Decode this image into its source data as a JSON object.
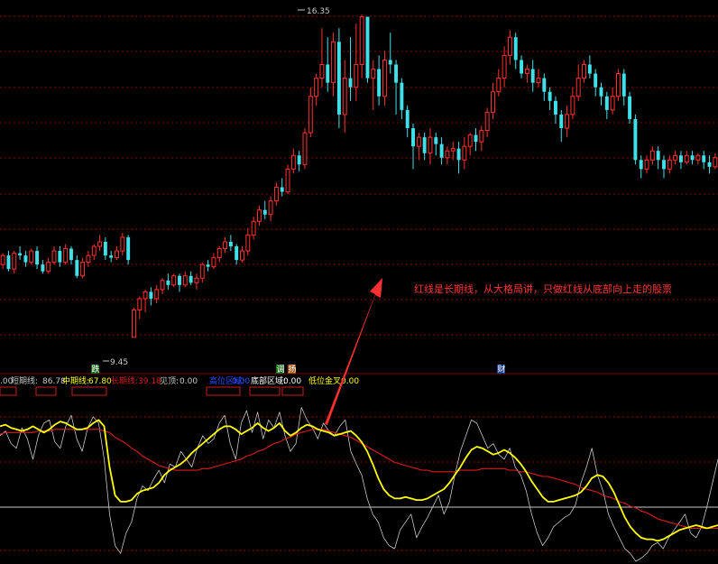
{
  "chart_data": [
    {
      "type": "candlestick",
      "price_high_label": "16.35",
      "price_low_label": "9.45",
      "ylim": [
        8.7,
        16.6
      ],
      "colors": {
        "up": "#ff3030",
        "down": "#40e0e8"
      },
      "candles": [
        [
          10.9,
          11.1,
          11.15,
          10.8
        ],
        [
          11.1,
          10.8,
          11.2,
          10.75
        ],
        [
          10.8,
          11.15,
          11.2,
          10.7
        ],
        [
          11.15,
          11.1,
          11.3,
          11.0
        ],
        [
          11.1,
          10.95,
          11.2,
          10.85
        ],
        [
          10.95,
          11.2,
          11.25,
          10.9
        ],
        [
          11.2,
          10.9,
          11.3,
          10.8
        ],
        [
          10.9,
          10.75,
          11.0,
          10.7
        ],
        [
          10.75,
          10.95,
          11.05,
          10.7
        ],
        [
          10.95,
          11.2,
          11.3,
          10.9
        ],
        [
          11.2,
          10.95,
          11.3,
          10.85
        ],
        [
          10.95,
          11.25,
          11.35,
          10.9
        ],
        [
          11.25,
          11.0,
          11.3,
          10.9
        ],
        [
          11.0,
          10.65,
          11.1,
          10.6
        ],
        [
          10.65,
          10.95,
          11.05,
          10.6
        ],
        [
          10.95,
          11.1,
          11.2,
          10.85
        ],
        [
          11.1,
          11.3,
          11.35,
          11.0
        ],
        [
          11.3,
          11.4,
          11.55,
          11.2
        ],
        [
          11.4,
          11.1,
          11.5,
          11.0
        ],
        [
          11.1,
          11.05,
          11.2,
          10.95
        ],
        [
          11.05,
          11.2,
          11.3,
          11.0
        ],
        [
          11.2,
          11.5,
          11.6,
          11.1
        ],
        [
          11.5,
          11.0,
          11.55,
          10.9
        ],
        [
          9.3,
          9.9,
          9.95,
          9.45
        ],
        [
          9.9,
          10.15,
          10.2,
          9.7
        ],
        [
          10.15,
          10.3,
          10.35,
          9.85
        ],
        [
          10.3,
          10.15,
          10.4,
          10.0
        ],
        [
          10.15,
          10.35,
          10.45,
          10.05
        ],
        [
          10.35,
          10.55,
          10.6,
          10.25
        ],
        [
          10.55,
          10.45,
          10.7,
          10.35
        ],
        [
          10.45,
          10.65,
          10.7,
          10.4
        ],
        [
          10.65,
          10.45,
          10.7,
          10.3
        ],
        [
          10.45,
          10.65,
          10.75,
          10.4
        ],
        [
          10.65,
          10.5,
          10.75,
          10.45
        ],
        [
          10.5,
          10.6,
          10.7,
          10.35
        ],
        [
          10.6,
          10.9,
          10.95,
          10.5
        ],
        [
          10.9,
          10.85,
          11.0,
          10.75
        ],
        [
          10.85,
          11.05,
          11.15,
          10.8
        ],
        [
          11.05,
          11.25,
          11.3,
          10.95
        ],
        [
          11.25,
          11.4,
          11.5,
          11.15
        ],
        [
          11.4,
          11.3,
          11.55,
          11.2
        ],
        [
          11.3,
          11.0,
          11.35,
          10.9
        ],
        [
          11.0,
          11.2,
          11.3,
          10.95
        ],
        [
          11.2,
          11.55,
          11.7,
          11.1
        ],
        [
          11.55,
          11.85,
          11.95,
          11.45
        ],
        [
          11.85,
          12.1,
          12.2,
          11.75
        ],
        [
          12.1,
          12.0,
          12.3,
          11.9
        ],
        [
          12.0,
          12.3,
          12.4,
          11.85
        ],
        [
          12.3,
          12.6,
          12.7,
          12.2
        ],
        [
          12.6,
          12.5,
          12.8,
          12.4
        ],
        [
          12.5,
          13.0,
          13.1,
          12.45
        ],
        [
          13.0,
          13.3,
          13.45,
          12.9
        ],
        [
          13.3,
          13.1,
          13.4,
          12.95
        ],
        [
          13.1,
          13.8,
          13.9,
          13.0
        ],
        [
          13.8,
          14.6,
          14.8,
          13.7
        ],
        [
          14.6,
          15.0,
          15.1,
          14.4
        ],
        [
          15.0,
          15.3,
          16.1,
          14.8
        ],
        [
          15.3,
          14.9,
          15.9,
          14.7
        ],
        [
          14.9,
          15.8,
          16.0,
          14.6
        ],
        [
          15.8,
          14.2,
          16.1,
          13.9
        ],
        [
          14.2,
          15.0,
          15.4,
          13.8
        ],
        [
          15.0,
          14.8,
          15.9,
          14.5
        ],
        [
          14.8,
          15.3,
          16.2,
          14.5
        ],
        [
          15.3,
          16.35,
          16.4,
          15.0
        ],
        [
          16.35,
          15.0,
          16.35,
          14.9
        ],
        [
          15.0,
          15.2,
          15.4,
          14.3
        ],
        [
          15.2,
          14.6,
          15.5,
          14.4
        ],
        [
          14.6,
          15.4,
          15.6,
          14.4
        ],
        [
          15.4,
          15.3,
          16.0,
          15.1
        ],
        [
          15.3,
          14.9,
          15.4,
          14.2
        ],
        [
          14.9,
          14.3,
          15.0,
          14.1
        ],
        [
          14.3,
          13.9,
          14.4,
          13.7
        ],
        [
          13.9,
          13.5,
          14.0,
          13.0
        ],
        [
          13.5,
          13.7,
          13.8,
          13.2
        ],
        [
          13.7,
          13.35,
          13.8,
          13.2
        ],
        [
          13.35,
          13.7,
          13.9,
          13.1
        ],
        [
          13.7,
          13.55,
          13.8,
          13.3
        ],
        [
          13.55,
          13.25,
          13.7,
          13.1
        ],
        [
          13.25,
          13.4,
          13.5,
          13.1
        ],
        [
          13.4,
          13.45,
          13.6,
          13.2
        ],
        [
          13.45,
          13.2,
          13.6,
          12.9
        ],
        [
          13.2,
          13.5,
          13.7,
          13.0
        ],
        [
          13.5,
          13.75,
          13.8,
          13.3
        ],
        [
          13.75,
          13.6,
          13.9,
          13.4
        ],
        [
          13.6,
          13.85,
          13.95,
          13.4
        ],
        [
          13.85,
          14.25,
          14.35,
          13.7
        ],
        [
          14.25,
          14.7,
          14.9,
          14.1
        ],
        [
          14.7,
          15.0,
          15.2,
          14.6
        ],
        [
          15.0,
          15.5,
          15.7,
          14.8
        ],
        [
          15.5,
          15.9,
          16.05,
          15.3
        ],
        [
          15.9,
          15.4,
          16.0,
          15.2
        ],
        [
          15.4,
          15.1,
          15.5,
          15.0
        ],
        [
          15.1,
          15.2,
          15.3,
          14.9
        ],
        [
          15.2,
          14.9,
          15.4,
          14.7
        ],
        [
          14.9,
          15.0,
          15.2,
          14.8
        ],
        [
          15.0,
          14.7,
          15.1,
          14.5
        ],
        [
          14.7,
          14.5,
          14.8,
          14.3
        ],
        [
          14.5,
          14.2,
          14.6,
          14.0
        ],
        [
          14.2,
          13.9,
          14.3,
          13.6
        ],
        [
          13.9,
          14.2,
          14.4,
          13.7
        ],
        [
          14.2,
          14.6,
          14.8,
          14.1
        ],
        [
          14.6,
          15.0,
          15.3,
          14.5
        ],
        [
          15.0,
          15.3,
          15.4,
          14.9
        ],
        [
          15.3,
          15.1,
          15.5,
          15.0
        ],
        [
          15.1,
          14.8,
          15.2,
          14.6
        ],
        [
          14.8,
          14.6,
          14.9,
          14.4
        ],
        [
          14.6,
          14.3,
          14.7,
          14.1
        ],
        [
          14.3,
          14.6,
          14.8,
          14.2
        ],
        [
          14.6,
          15.1,
          15.2,
          14.5
        ],
        [
          15.1,
          14.6,
          15.2,
          14.4
        ],
        [
          14.6,
          14.1,
          14.7,
          14.0
        ],
        [
          14.1,
          13.2,
          14.2,
          13.1
        ],
        [
          13.2,
          13.0,
          13.3,
          12.8
        ],
        [
          13.0,
          13.2,
          13.3,
          12.9
        ],
        [
          13.2,
          13.4,
          13.5,
          13.1
        ],
        [
          13.4,
          13.2,
          13.5,
          13.0
        ],
        [
          13.2,
          13.0,
          13.3,
          12.8
        ],
        [
          13.0,
          13.2,
          13.3,
          12.9
        ],
        [
          13.2,
          13.3,
          13.4,
          13.1
        ],
        [
          13.3,
          13.15,
          13.4,
          13.0
        ],
        [
          13.15,
          13.3,
          13.4,
          13.1
        ],
        [
          13.3,
          13.2,
          13.4,
          13.1
        ],
        [
          13.2,
          13.3,
          13.35,
          13.1
        ],
        [
          13.3,
          13.15,
          13.4,
          13.0
        ],
        [
          13.15,
          13.05,
          13.3,
          12.9
        ],
        [
          13.05,
          13.25,
          13.35,
          13.0
        ]
      ]
    },
    {
      "type": "line",
      "series": [
        {
          "name": "中期线",
          "color": "#ffff00",
          "values": [
            86,
            87,
            85,
            84,
            83,
            84,
            86,
            84,
            82,
            84,
            87,
            89,
            88,
            86,
            84,
            84,
            85,
            88,
            90,
            86,
            60,
            42,
            38,
            38,
            39,
            43,
            45,
            46,
            47,
            50,
            55,
            58,
            60,
            62,
            65,
            69,
            72,
            75,
            78,
            81,
            84,
            86,
            86,
            84,
            81,
            83,
            85,
            88,
            85,
            83,
            85,
            88,
            83,
            80,
            82,
            85,
            87,
            86,
            84,
            83,
            82,
            80,
            81,
            82,
            83,
            80,
            76,
            70,
            62,
            53,
            46,
            42,
            40,
            40,
            41,
            40,
            39,
            39,
            40,
            42,
            44,
            46,
            50,
            55,
            60,
            66,
            71,
            73,
            72,
            70,
            68,
            69,
            71,
            69,
            66,
            62,
            57,
            51,
            46,
            41,
            38,
            38,
            39,
            40,
            41,
            42,
            44,
            48,
            53,
            55,
            54,
            50,
            44,
            36,
            28,
            22,
            18,
            15,
            14,
            14,
            13,
            14,
            16,
            18,
            20,
            21,
            22,
            23,
            22,
            21,
            22,
            23
          ]
        },
        {
          "name": "长期线",
          "color": "#dd1a1a",
          "values": [
            81,
            82,
            82,
            82,
            82,
            82,
            82,
            83,
            83,
            83,
            84,
            84,
            84,
            84,
            84,
            84,
            84,
            84,
            84,
            83,
            82,
            79,
            77,
            75,
            72,
            70,
            67,
            65,
            63,
            61,
            60,
            59,
            58,
            58,
            58,
            58,
            58,
            59,
            59,
            60,
            61,
            62,
            63,
            64,
            65,
            67,
            68,
            70,
            71,
            73,
            75,
            76,
            78,
            79,
            81,
            82,
            83,
            84,
            84,
            84,
            83,
            82,
            81,
            80,
            79,
            77,
            75,
            73,
            71,
            69,
            67,
            65,
            63,
            62,
            61,
            60,
            59,
            58,
            58,
            57,
            57,
            57,
            57,
            57,
            58,
            58,
            58,
            58,
            59,
            59,
            59,
            59,
            59,
            58,
            58,
            57,
            57,
            56,
            55,
            54,
            54,
            53,
            52,
            51,
            50,
            49,
            47,
            46,
            45,
            44,
            42,
            41,
            40,
            38,
            37,
            35,
            34,
            32,
            31,
            29,
            27,
            26,
            25,
            24,
            23,
            22,
            21,
            21,
            21,
            21,
            21,
            21
          ]
        },
        {
          "name": "短期线",
          "color": "#c8c8c8",
          "values": [
            80,
            83,
            75,
            72,
            85,
            78,
            65,
            80,
            88,
            90,
            76,
            72,
            86,
            93,
            78,
            70,
            85,
            92,
            88,
            65,
            30,
            10,
            5,
            18,
            25,
            40,
            48,
            45,
            52,
            58,
            50,
            62,
            60,
            70,
            65,
            60,
            72,
            80,
            75,
            78,
            88,
            93,
            75,
            65,
            88,
            96,
            82,
            95,
            78,
            90,
            85,
            95,
            80,
            70,
            75,
            98,
            90,
            85,
            78,
            88,
            83,
            80,
            86,
            90,
            70,
            62,
            55,
            40,
            30,
            25,
            15,
            10,
            8,
            20,
            25,
            30,
            15,
            22,
            28,
            35,
            42,
            30,
            38,
            55,
            70,
            80,
            90,
            88,
            80,
            72,
            75,
            68,
            65,
            72,
            60,
            55,
            45,
            30,
            18,
            10,
            15,
            22,
            25,
            28,
            30,
            36,
            50,
            60,
            72,
            55,
            45,
            30,
            22,
            15,
            8,
            5,
            0,
            2,
            5,
            10,
            12,
            8,
            15,
            20,
            25,
            30,
            18,
            15,
            22,
            35,
            50,
            65
          ]
        }
      ],
      "ylim": [
        0,
        100
      ]
    }
  ],
  "indicator": {
    "start_value": ".00",
    "short_label": "短期线:",
    "short_value": "86.78",
    "mid_label": "中期线:",
    "mid_value": "67.80",
    "long_label": "长期线:",
    "long_value": "39.18",
    "jd_label": "见顶:",
    "jd_value": "0.00",
    "high_zone_label": "高位区域:",
    "high_zone_value": "0.00",
    "bottom_label": "底部区域:",
    "bottom_value": "0.00",
    "golden_label": "低位金叉:",
    "golden_value": "0.00"
  },
  "markers": {
    "drop": "跌",
    "calm": "调",
    "raise": "扬",
    "finance": "财"
  },
  "annotation": {
    "text": "红线是长期线，从大格局讲，只做红线从底部向上走的股票",
    "color": "#ff3333"
  },
  "colors": {
    "grid": "#8a0000",
    "separator": "#c8c8c8"
  }
}
